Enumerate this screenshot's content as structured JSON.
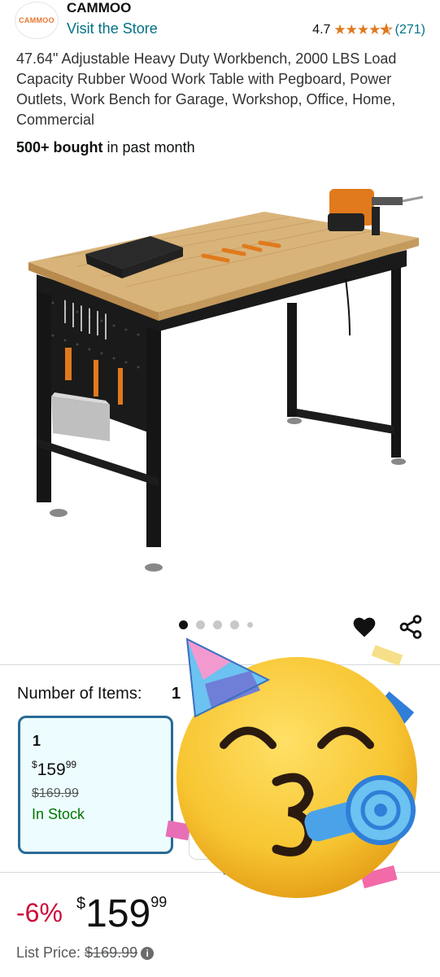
{
  "store": {
    "logo_text": "CAMMOO",
    "brand": "CAMMOO",
    "visit_label": "Visit the Store"
  },
  "rating": {
    "value": "4.7",
    "stars": 4.7,
    "review_count": "(271)"
  },
  "product": {
    "title": "47.64\" Adjustable Heavy Duty Workbench, 2000 LBS Load Capacity Rubber Wood Work Table with Pegboard, Power Outlets, Work Bench for Garage, Workshop, Office, Home, Commercial",
    "bought_bold": "500+ bought",
    "bought_rest": " in past month",
    "image_icon": "workbench-image"
  },
  "carousel": {
    "dot_count": 5,
    "active_index": 0
  },
  "actions": {
    "wishlist_icon": "heart-icon",
    "share_icon": "share-icon"
  },
  "options": {
    "label": "Number of Items:",
    "selected": "1",
    "cards": [
      {
        "count": "1",
        "currency": "$",
        "whole": "159",
        "cents": "99",
        "list_price": "$169.99",
        "stock": "In Stock"
      }
    ]
  },
  "pricing": {
    "discount": "-6%",
    "currency": "$",
    "whole": "159",
    "cents": "99",
    "list_label": "List Price:",
    "list_value": "$169.99"
  },
  "overlay": {
    "sticker": "partying-face-emoji"
  },
  "colors": {
    "link": "#007185",
    "star": "#de7921",
    "discount": "#cc0c39",
    "in_stock": "#007600",
    "selected_border": "#2a6a95"
  }
}
